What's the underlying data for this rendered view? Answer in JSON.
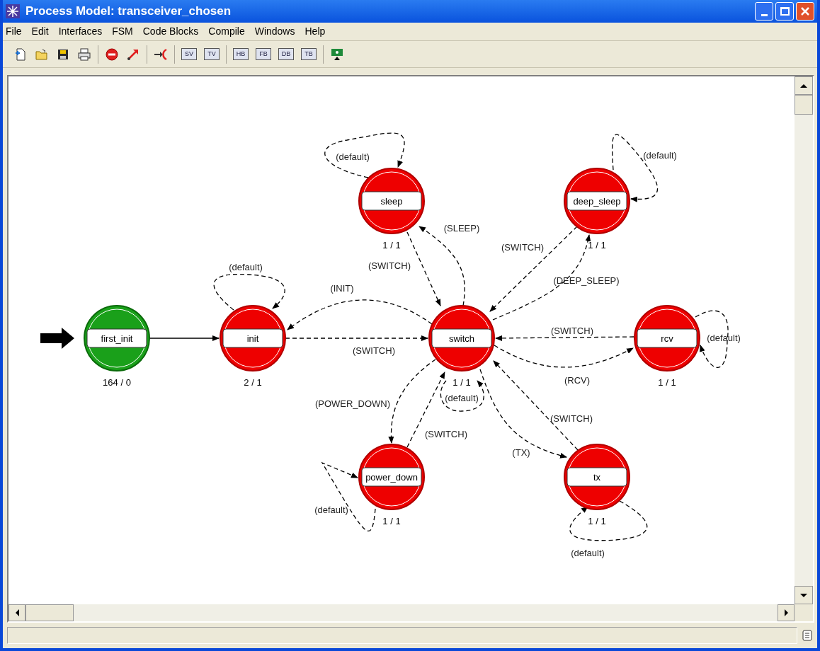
{
  "window": {
    "title": "Process Model: transceiver_chosen"
  },
  "menu": [
    "File",
    "Edit",
    "Interfaces",
    "FSM",
    "Code Blocks",
    "Compile",
    "Windows",
    "Help"
  ],
  "toolbar": [
    {
      "kind": "new"
    },
    {
      "kind": "open"
    },
    {
      "kind": "save"
    },
    {
      "kind": "print"
    },
    {
      "kind": "sep"
    },
    {
      "kind": "stop"
    },
    {
      "kind": "transition"
    },
    {
      "kind": "sep"
    },
    {
      "kind": "merge"
    },
    {
      "kind": "sep"
    },
    {
      "kind": "text",
      "label": "SV"
    },
    {
      "kind": "text",
      "label": "TV"
    },
    {
      "kind": "sep"
    },
    {
      "kind": "text",
      "label": "HB"
    },
    {
      "kind": "text",
      "label": "FB"
    },
    {
      "kind": "text",
      "label": "DB"
    },
    {
      "kind": "text",
      "label": "TB"
    },
    {
      "kind": "sep"
    },
    {
      "kind": "compile"
    }
  ],
  "states": [
    {
      "name": "first_init",
      "kind": "forced",
      "count": "164 / 0",
      "initial": true
    },
    {
      "name": "init",
      "kind": "unforced",
      "count": "2 / 1",
      "initial": false
    },
    {
      "name": "switch",
      "kind": "unforced",
      "count": "1 / 1",
      "initial": false
    },
    {
      "name": "sleep",
      "kind": "unforced",
      "count": "1 / 1",
      "initial": false
    },
    {
      "name": "deep_sleep",
      "kind": "unforced",
      "count": "1 / 1",
      "initial": false
    },
    {
      "name": "rcv",
      "kind": "unforced",
      "count": "1 / 1",
      "initial": false
    },
    {
      "name": "power_down",
      "kind": "unforced",
      "count": "1 / 1",
      "initial": false
    },
    {
      "name": "tx",
      "kind": "unforced",
      "count": "1 / 1",
      "initial": false
    }
  ],
  "transitions": [
    {
      "kind": "conditional",
      "label": "(default)"
    },
    {
      "kind": "conditional",
      "label": "(default)"
    },
    {
      "kind": "conditional",
      "label": "(SLEEP)"
    },
    {
      "kind": "conditional",
      "label": "(SWITCH)"
    },
    {
      "kind": "conditional",
      "label": "(SWITCH)"
    },
    {
      "kind": "conditional",
      "label": "(default)"
    },
    {
      "kind": "conditional",
      "label": "(DEEP_SLEEP)"
    },
    {
      "kind": "conditional",
      "label": "(INIT)"
    },
    {
      "kind": "conditional",
      "label": "(SWITCH)"
    },
    {
      "kind": "conditional",
      "label": "(default)"
    },
    {
      "kind": "unconditional"
    },
    {
      "kind": "conditional",
      "label": "(SWITCH)"
    },
    {
      "kind": "conditional",
      "label": "(RCV)"
    },
    {
      "kind": "conditional",
      "label": "(default)"
    },
    {
      "kind": "conditional",
      "label": "(POWER_DOWN)"
    },
    {
      "kind": "conditional",
      "label": "(SWITCH)"
    },
    {
      "kind": "conditional",
      "label": "(SWITCH)"
    },
    {
      "kind": "conditional",
      "label": "(TX)"
    },
    {
      "kind": "conditional",
      "label": "(default)"
    },
    {
      "kind": "conditional",
      "label": "(default)"
    }
  ]
}
